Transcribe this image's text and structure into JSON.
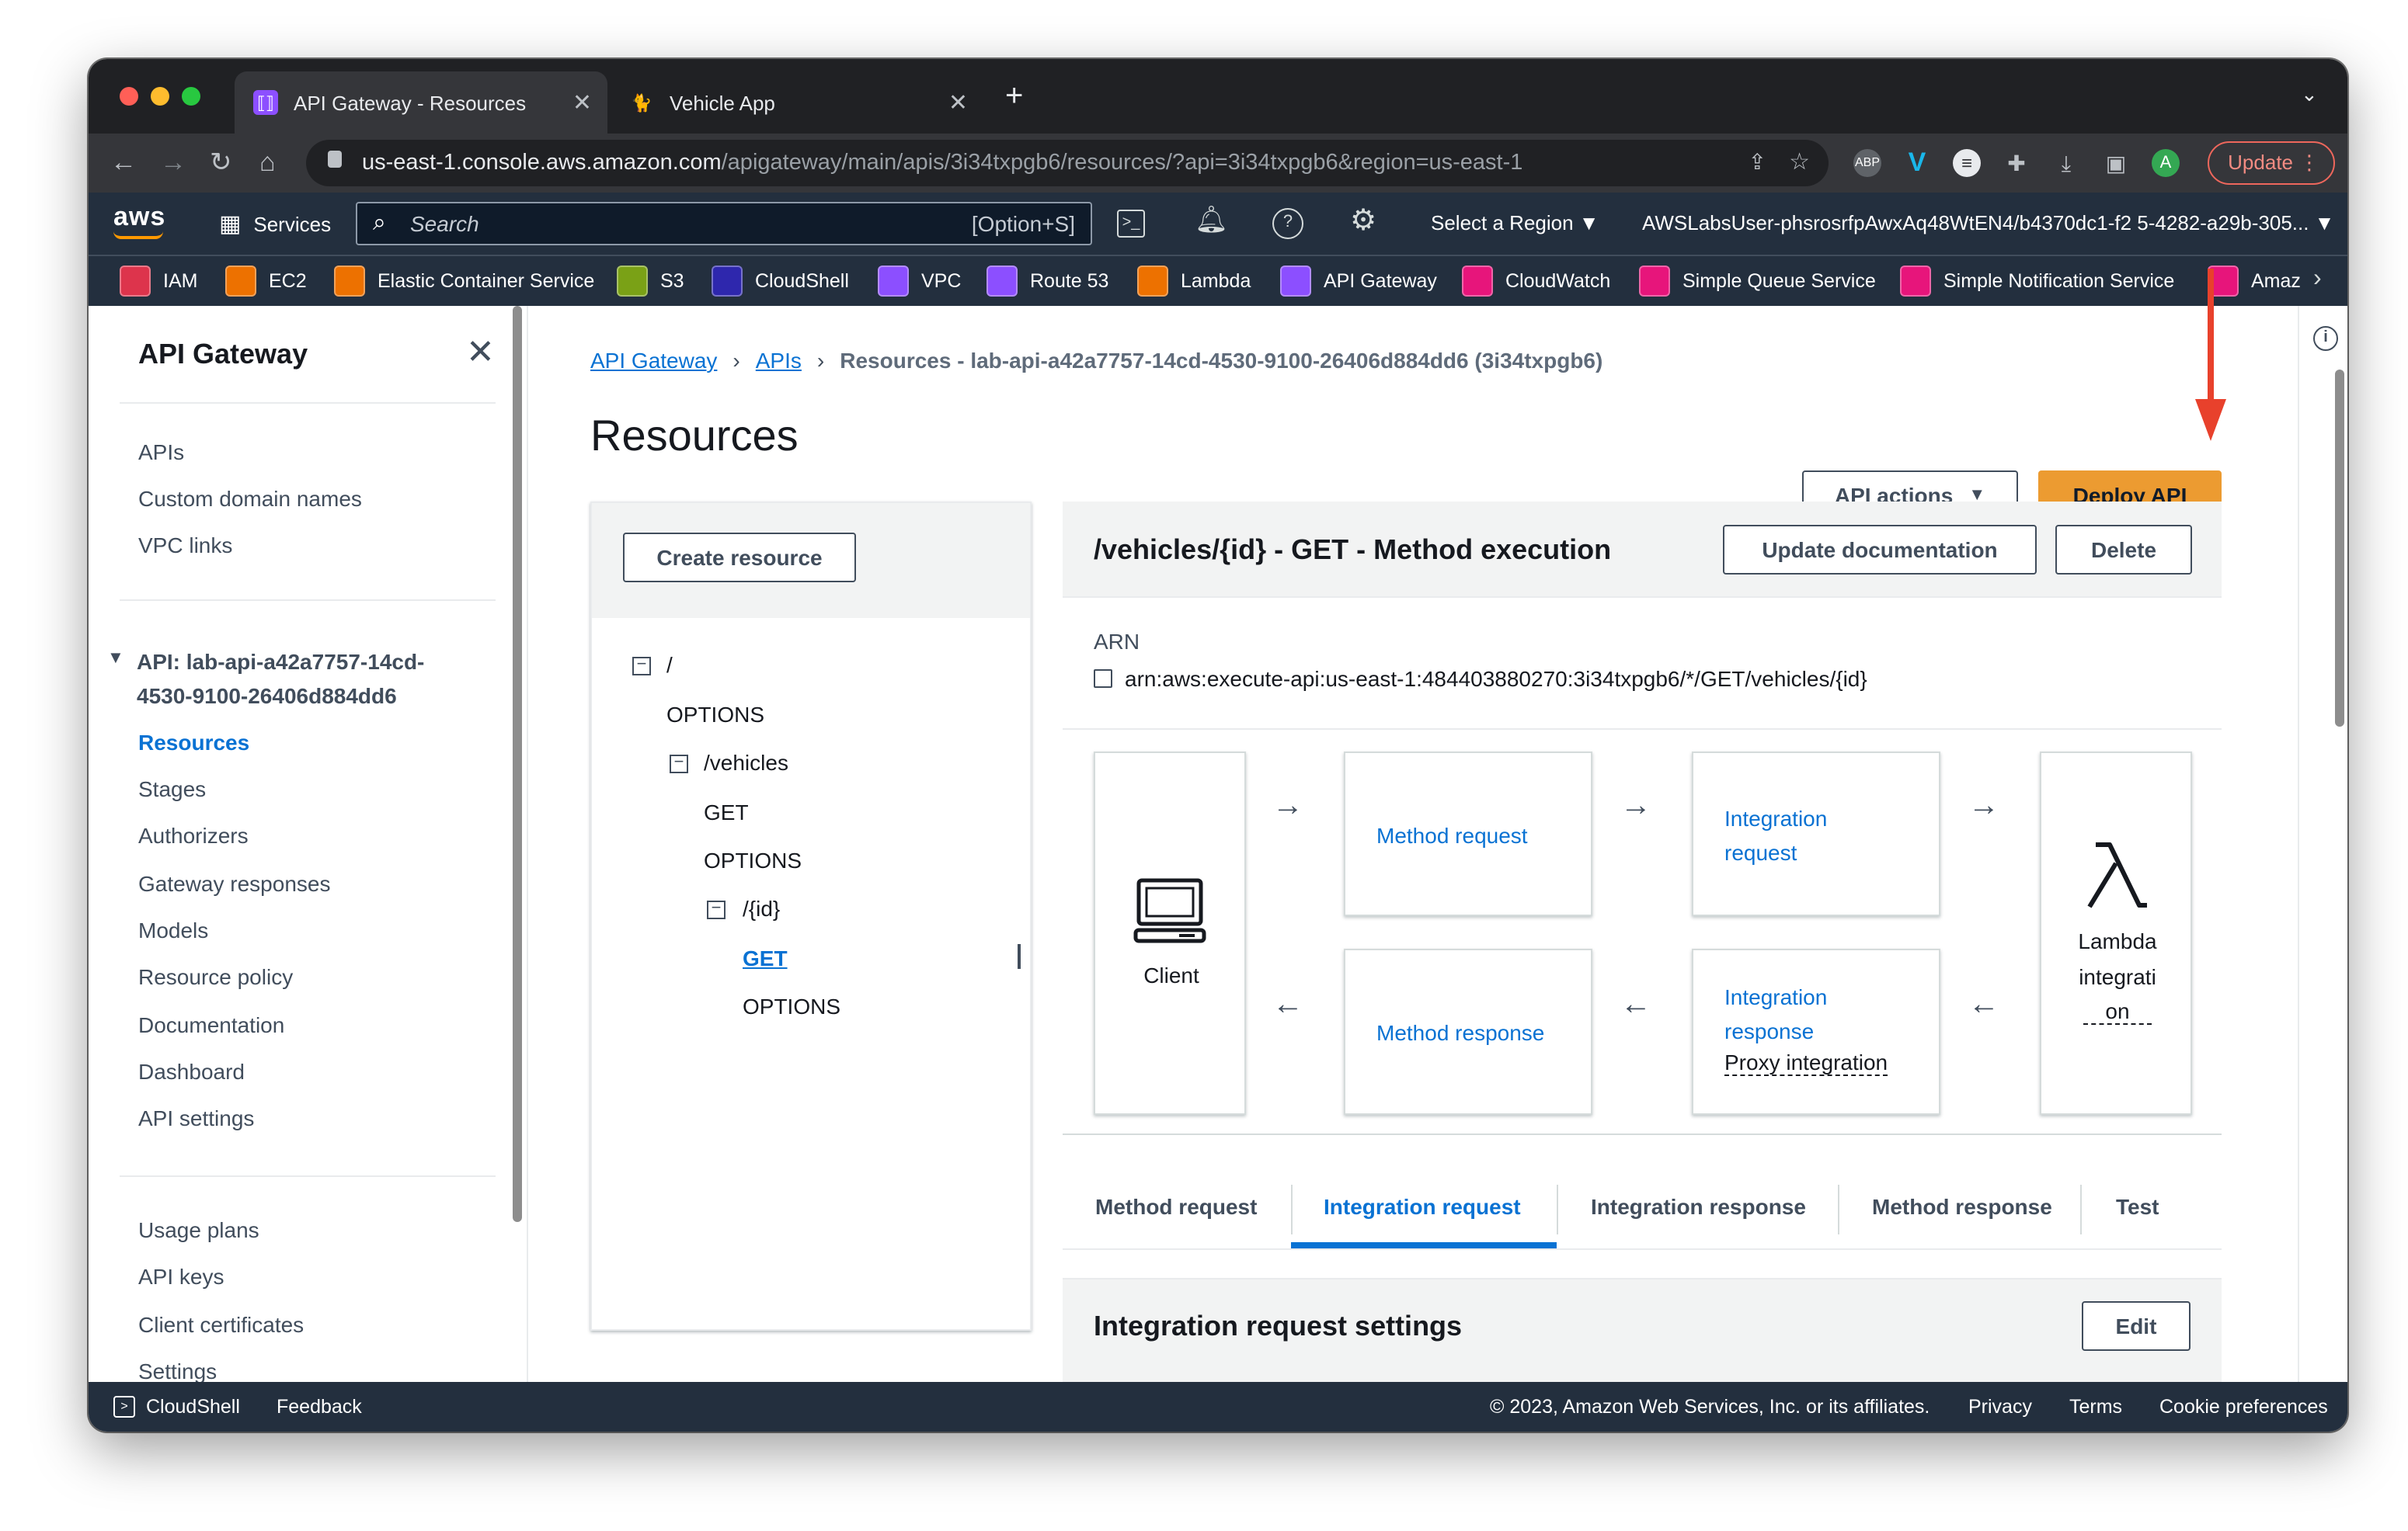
{
  "browser": {
    "tabs": [
      {
        "title": "API Gateway - Resources",
        "active": true
      },
      {
        "title": "Vehicle App",
        "active": false
      }
    ],
    "new_tab": "+",
    "url_host": "us-east-1.console.aws.amazon.com",
    "url_path": "/apigateway/main/apis/3i34txpgb6/resources/?api=3i34txpgb6&region=us-east-1",
    "update_label": "Update",
    "profile_initial": "A"
  },
  "aws_nav": {
    "logo": "aws",
    "services": "Services",
    "search_placeholder": "Search",
    "search_shortcut": "[Option+S]",
    "region": "Select a Region ▼",
    "account": "AWSLabsUser-phsrosrfpAwxAq48WtEN4/b4370dc1-f2 5-4282-a29b-305... ▼"
  },
  "bookmarks": [
    {
      "label": "IAM",
      "color": "#dd344c"
    },
    {
      "label": "EC2",
      "color": "#ed7100"
    },
    {
      "label": "Elastic Container Service",
      "color": "#ed7100"
    },
    {
      "label": "S3",
      "color": "#7aa116"
    },
    {
      "label": "CloudShell",
      "color": "#2e27ad"
    },
    {
      "label": "VPC",
      "color": "#8c4fff"
    },
    {
      "label": "Route 53",
      "color": "#8c4fff"
    },
    {
      "label": "Lambda",
      "color": "#ed7100"
    },
    {
      "label": "API Gateway",
      "color": "#8c4fff"
    },
    {
      "label": "CloudWatch",
      "color": "#e7157b"
    },
    {
      "label": "Simple Queue Service",
      "color": "#e7157b"
    },
    {
      "label": "Simple Notification Service",
      "color": "#e7157b"
    },
    {
      "label": "Amaz",
      "color": "#e7157b"
    }
  ],
  "sidebar": {
    "title": "API Gateway",
    "group1": [
      "APIs",
      "Custom domain names",
      "VPC links"
    ],
    "api_label_1": "API: lab-api-a42a7757-14cd-",
    "api_label_2": "4530-9100-26406d884dd6",
    "group2": [
      "Resources",
      "Stages",
      "Authorizers",
      "Gateway responses",
      "Models",
      "Resource policy",
      "Documentation",
      "Dashboard",
      "API settings"
    ],
    "group3": [
      "Usage plans",
      "API keys",
      "Client certificates",
      "Settings"
    ]
  },
  "breadcrumb": {
    "items": [
      "API Gateway",
      "APIs"
    ],
    "current": "Resources - lab-api-a42a7757-14cd-4530-9100-26406d884dd6 (3i34txpgb6)"
  },
  "page": {
    "title": "Resources",
    "api_actions": "API actions",
    "deploy": "Deploy API"
  },
  "resources_panel": {
    "create": "Create resource",
    "tree": [
      {
        "label": "/",
        "kind": "resource"
      },
      {
        "label": "OPTIONS",
        "kind": "method"
      },
      {
        "label": "/vehicles",
        "kind": "resource"
      },
      {
        "label": "GET",
        "kind": "method"
      },
      {
        "label": "OPTIONS",
        "kind": "method"
      },
      {
        "label": "/{id}",
        "kind": "resource"
      },
      {
        "label": "GET",
        "kind": "method",
        "selected": true
      },
      {
        "label": "OPTIONS",
        "kind": "method"
      }
    ]
  },
  "method": {
    "title": "/vehicles/{id} - GET - Method execution",
    "update_doc": "Update documentation",
    "delete": "Delete",
    "arn_label": "ARN",
    "arn": "arn:aws:execute-api:us-east-1:484403880270:3i34txpgb6/*/GET/vehicles/{id}",
    "flow": {
      "client": "Client",
      "method_request": "Method request",
      "integration_request_1": "Integration",
      "integration_request_2": "request",
      "method_response": "Method response",
      "integration_response_1": "Integration",
      "integration_response_2": "response",
      "proxy": "Proxy integration",
      "lambda_1": "Lambda",
      "lambda_2": "integrati",
      "lambda_3": "on"
    },
    "tabs": [
      "Method request",
      "Integration request",
      "Integration response",
      "Method response",
      "Test"
    ],
    "active_tab": "Integration request",
    "settings_title": "Integration request settings",
    "edit": "Edit"
  },
  "footer": {
    "cloudshell": "CloudShell",
    "feedback": "Feedback",
    "copyright": "© 2023, Amazon Web Services, Inc. or its affiliates.",
    "privacy": "Privacy",
    "terms": "Terms",
    "cookies": "Cookie preferences"
  },
  "colors": {
    "accent": "#0972d3",
    "deploy": "#ec9b31",
    "annotation_arrow": "#e8412c",
    "nav": "#232f3e"
  }
}
